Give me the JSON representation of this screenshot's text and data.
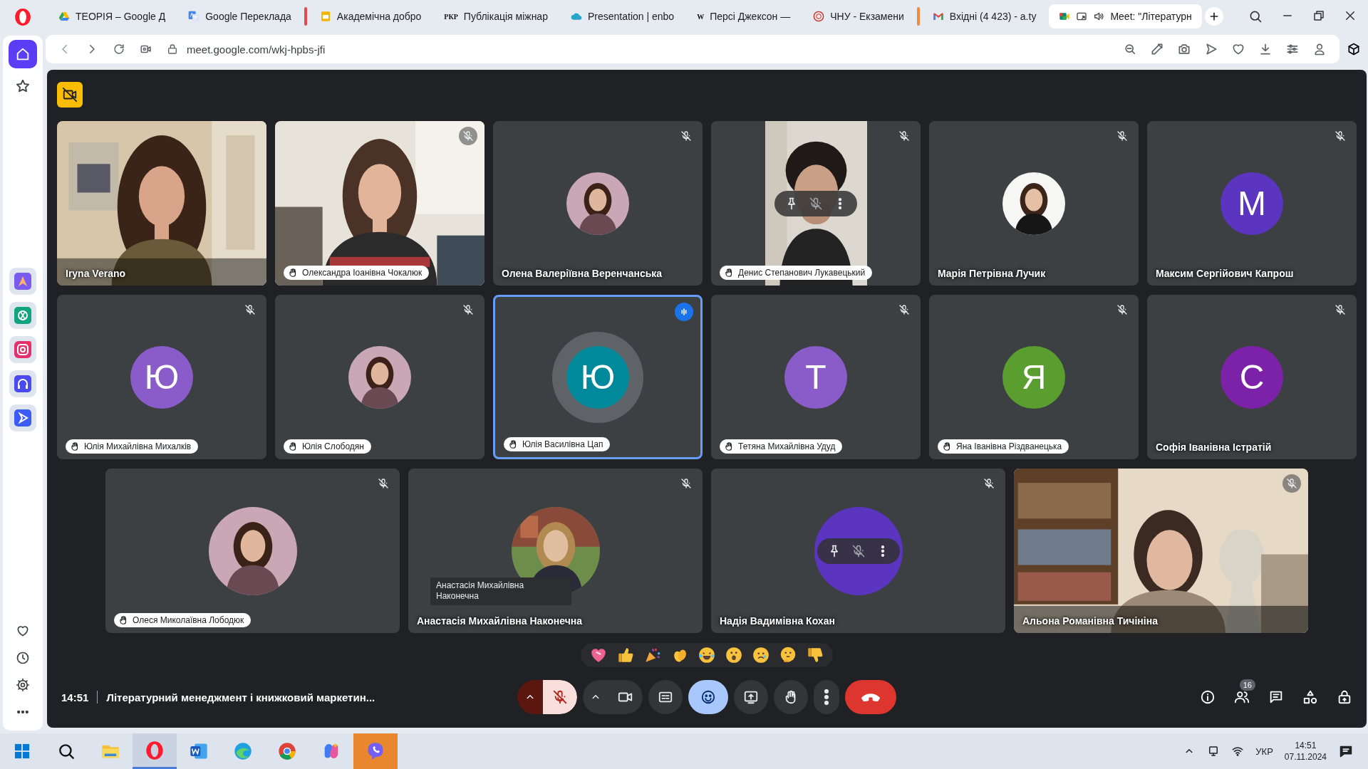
{
  "browser": {
    "tabs": [
      {
        "kind": "drive",
        "title": "ТЕОРІЯ – Google Д",
        "selected": false
      },
      {
        "kind": "translate",
        "title": "Google Перекладa",
        "selected": false
      },
      {
        "kind": "slides",
        "title": "Академічна добро",
        "selected": false,
        "color": "#e5484d"
      },
      {
        "kind": "letters",
        "icon_text": "РКР",
        "title": "Публікація міжнар",
        "selected": false
      },
      {
        "kind": "cloud",
        "title": "Presentation | enbo",
        "selected": false
      },
      {
        "kind": "letters",
        "icon_text": "W",
        "title": "Персі Джексон —",
        "selected": false
      },
      {
        "kind": "seal",
        "title": "ЧНУ - Екзамени",
        "selected": false
      },
      {
        "kind": "gmail",
        "title": "Вхідні (4 423) - a.ty",
        "selected": false,
        "color": "#f08a3c"
      },
      {
        "kind": "meet",
        "title": "Meet: \"Літературн",
        "selected": true
      }
    ],
    "address": "meet.google.com/wkj-hpbs-jfi"
  },
  "meeting": {
    "grid_rows": [
      [
        {
          "name": "Iryna Verano",
          "kind": "video",
          "hand_raised": false,
          "muted": false,
          "speaking": false
        },
        {
          "name": "Олександра Іоанівна Чокалюк",
          "kind": "video",
          "hand_raised": true,
          "muted": true,
          "speaking": false
        },
        {
          "name": "Олена Валеріївна Веренчанська",
          "hand_raised": false,
          "muted": true,
          "speaking": false
        },
        {
          "name": "Денис Степанович Лукавецький",
          "kind": "video-narrow",
          "hand_raised": true,
          "muted": true,
          "speaking": false,
          "hover_controls": true
        },
        {
          "name": "Марія Петрівна Лучик",
          "hand_raised": false,
          "muted": true,
          "speaking": false
        },
        {
          "name": "Максим Сергійович Капрош",
          "kind": "letter",
          "letter": "M",
          "color": "#5b34c0",
          "hand_raised": false,
          "muted": true,
          "speaking": false
        }
      ],
      [
        {
          "name": "Юлія Михайлівна Михалків",
          "kind": "letter",
          "letter": "Ю",
          "color": "#8a5cc9",
          "hand_raised": true,
          "muted": true,
          "speaking": false
        },
        {
          "name": "Юлія Слободян",
          "hand_raised": true,
          "muted": true,
          "speaking": false
        },
        {
          "name": "Юлія Василівна Цап",
          "kind": "letter",
          "letter": "Ю",
          "color": "#00899a",
          "hand_raised": true,
          "muted": false,
          "speaking": true
        },
        {
          "name": "Тетяна Михайлівна Удуд",
          "kind": "letter",
          "letter": "Т",
          "color": "#8a5cc9",
          "hand_raised": true,
          "muted": true,
          "speaking": false
        },
        {
          "name": "Яна Іванівна Різдванецька",
          "kind": "letter",
          "letter": "Я",
          "color": "#5a9e2f",
          "hand_raised": true,
          "muted": true,
          "speaking": false
        },
        {
          "name": "Софія Іванівна Істратій",
          "kind": "letter",
          "letter": "С",
          "color": "#7b22a8",
          "hand_raised": false,
          "muted": true,
          "speaking": false
        }
      ],
      [
        {
          "name": "Олеся Миколаївна Лободюк",
          "hand_raised": true,
          "muted": true,
          "speaking": false
        },
        {
          "name": "Анастасія Михайлівна Наконечна",
          "hand_raised": false,
          "muted": true,
          "speaking": false,
          "tooltip": "Анастасія Михайлівна Наконечна"
        },
        {
          "name": "Надія Вадимівна Кохан",
          "kind": "letter",
          "color": "#5b34c0",
          "hand_raised": false,
          "muted": true,
          "speaking": false,
          "hover_controls": true
        },
        {
          "name": "Альона Романівна Тичініна",
          "kind": "video",
          "hand_raised": false,
          "muted": true,
          "speaking": false
        }
      ]
    ],
    "time": "14:51",
    "title": "Літературний менеджмент і книжковий маркетин...",
    "people_count": "16",
    "controls": {
      "mic_muted": true,
      "reactions_selected": true
    }
  },
  "taskbar": {
    "language": "УКР",
    "time": "14:51",
    "date": "07.11.2024"
  }
}
